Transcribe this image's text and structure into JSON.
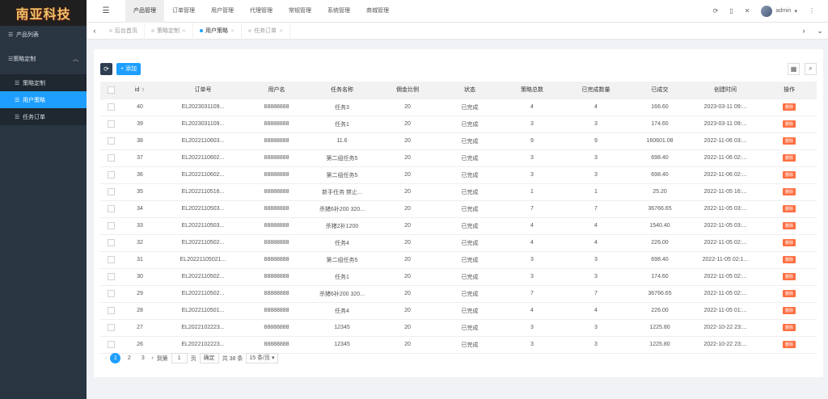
{
  "logo": {
    "text": "南亚科技"
  },
  "sidebar": {
    "items": [
      {
        "label": "产品列表"
      },
      {
        "label": "策略定制"
      },
      {
        "label": "策略定制"
      },
      {
        "label": "用户策略"
      },
      {
        "label": "任务订单"
      }
    ]
  },
  "topnav": {
    "tabs": [
      "产品管理",
      "订单管理",
      "用户管理",
      "代理管理",
      "常规管理",
      "系统管理",
      "商城管理"
    ],
    "user": "admin"
  },
  "tabbar": {
    "tabs": [
      {
        "label": "后台首页"
      },
      {
        "label": "策略定制"
      },
      {
        "label": "用户策略"
      },
      {
        "label": "任务订单"
      }
    ]
  },
  "toolbar": {
    "add_label": "+ 添加"
  },
  "table": {
    "headers": [
      "id",
      "订单号",
      "用户名",
      "任务名称",
      "佣金比例",
      "状态",
      "策略总数",
      "已完成数量",
      "已成交",
      "创建时间",
      "操作"
    ],
    "action_label": "删除",
    "rows": [
      [
        "40",
        "EL2023031109...",
        "88888888",
        "任务3",
        "20",
        "已完成",
        "4",
        "4",
        "166.60",
        "2023-03-11 09:..."
      ],
      [
        "39",
        "EL2023031109...",
        "88888888",
        "任务1",
        "20",
        "已完成",
        "3",
        "3",
        "174.60",
        "2023-03-11 09:..."
      ],
      [
        "38",
        "EL2022110603...",
        "88888888",
        "11.6",
        "20",
        "已完成",
        "9",
        "9",
        "160601.08",
        "2022-11-06 03:..."
      ],
      [
        "37",
        "EL2022110602...",
        "88888888",
        "第二组任务5",
        "20",
        "已完成",
        "3",
        "3",
        "698.40",
        "2022-11-06 02:..."
      ],
      [
        "36",
        "EL2022110602...",
        "88888888",
        "第二组任务5",
        "20",
        "已完成",
        "3",
        "3",
        "698.40",
        "2022-11-06 02:..."
      ],
      [
        "35",
        "EL2022110516...",
        "88888888",
        "新手任务 禁止...",
        "20",
        "已完成",
        "1",
        "1",
        "25.20",
        "2022-11-05 16:..."
      ],
      [
        "34",
        "EL2022110503...",
        "88888888",
        "杀猪6补200 320...",
        "20",
        "已完成",
        "7",
        "7",
        "36766.65",
        "2022-11-05 03:..."
      ],
      [
        "33",
        "EL2022110503...",
        "88888888",
        "杀猪2补1200",
        "20",
        "已完成",
        "4",
        "4",
        "1540.40",
        "2022-11-05 03:..."
      ],
      [
        "32",
        "EL2022110502...",
        "88888888",
        "任务4",
        "20",
        "已完成",
        "4",
        "4",
        "226.00",
        "2022-11-05 02:..."
      ],
      [
        "31",
        "EL20221105021...",
        "88888888",
        "第二组任务5",
        "20",
        "已完成",
        "3",
        "3",
        "698.40",
        "2022-11-05 02:1..."
      ],
      [
        "30",
        "EL2022110502...",
        "88888888",
        "任务1",
        "20",
        "已完成",
        "3",
        "3",
        "174.60",
        "2022-11-05 02:..."
      ],
      [
        "29",
        "EL2022110502...",
        "88888888",
        "杀猪6补200 320...",
        "20",
        "已完成",
        "7",
        "7",
        "36766.65",
        "2022-11-05 02:..."
      ],
      [
        "28",
        "EL2022110501...",
        "88888888",
        "任务4",
        "20",
        "已完成",
        "4",
        "4",
        "226.00",
        "2022-11-05 01:..."
      ],
      [
        "27",
        "EL2022102223...",
        "88888888",
        "12345",
        "20",
        "已完成",
        "3",
        "3",
        "1225.80",
        "2022-10-22 23:..."
      ],
      [
        "26",
        "EL2022102223...",
        "88888888",
        "12345",
        "20",
        "已完成",
        "3",
        "3",
        "1225.80",
        "2022-10-22 23:..."
      ]
    ]
  },
  "pager": {
    "pages": [
      "1",
      "2",
      "3"
    ],
    "goto_label": "到第",
    "page_input": "1",
    "page_unit": "页",
    "confirm": "确定",
    "total": "共 38 条",
    "per_page": "15 条/页"
  },
  "icons": {
    "menu": "hamburger-icon",
    "refresh": "refresh-icon",
    "columns": "columns-icon",
    "search": "search-icon"
  },
  "colors": {
    "accent": "#1e9fff",
    "sidebar": "#2a3542",
    "delete": "#ff5722"
  }
}
